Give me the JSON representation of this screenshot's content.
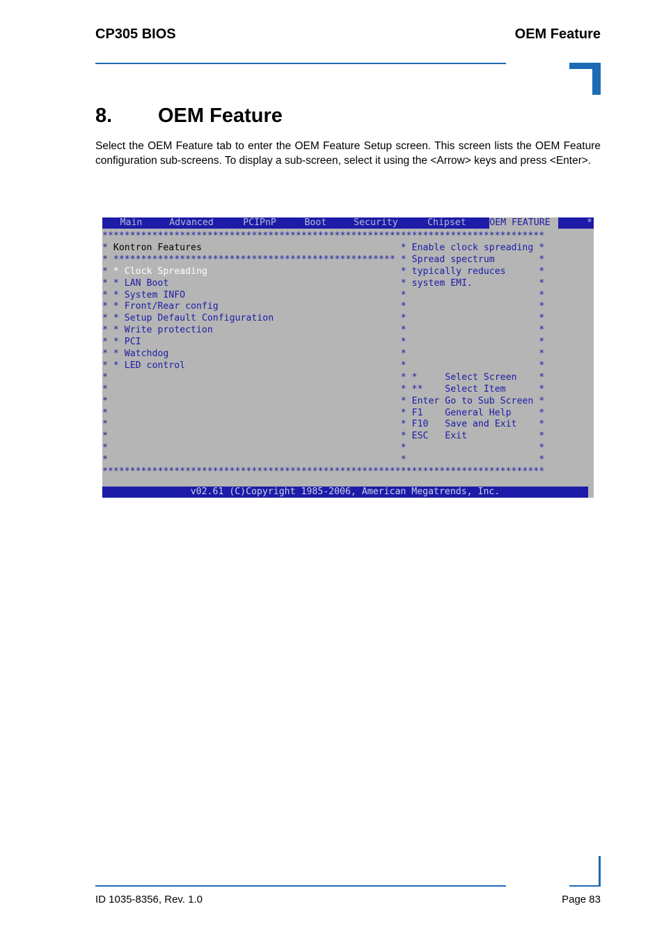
{
  "header": {
    "left": "CP305 BIOS",
    "right": "OEM Feature"
  },
  "section": {
    "number": "8.",
    "title": "OEM Feature"
  },
  "intro": "Select the OEM Feature tab to enter the OEM Feature Setup screen. This screen lists the OEM Feature configuration sub-screens. To display a sub-screen, select it using the <Arrow> keys and press <Enter>.",
  "bios": {
    "tabs": [
      {
        "label": "Main",
        "active": false
      },
      {
        "label": "Advanced",
        "active": false
      },
      {
        "label": "PCIPnP",
        "active": false
      },
      {
        "label": "Boot",
        "active": false
      },
      {
        "label": "Security",
        "active": false
      },
      {
        "label": "Chipset",
        "active": false
      },
      {
        "label": "OEM FEATURE",
        "active": true
      }
    ],
    "panel_title": "Kontron Features",
    "items": [
      {
        "label": "Clock Spreading",
        "selected": true
      },
      {
        "label": "LAN Boot",
        "selected": false
      },
      {
        "label": "System INFO",
        "selected": false
      },
      {
        "label": "Front/Rear config",
        "selected": false
      },
      {
        "label": "Setup Default Configuration",
        "selected": false
      },
      {
        "label": "Write protection",
        "selected": false
      },
      {
        "label": "PCI",
        "selected": false
      },
      {
        "label": "Watchdog",
        "selected": false
      },
      {
        "label": "LED control",
        "selected": false
      }
    ],
    "help_text": [
      "Enable clock spreading",
      "Spread spectrum",
      "typically reduces",
      "system EMI."
    ],
    "keys": [
      {
        "key": "*",
        "action": "Select Screen"
      },
      {
        "key": "**",
        "action": "Select Item"
      },
      {
        "key": "Enter",
        "action": "Go to Sub Screen"
      },
      {
        "key": "F1",
        "action": "General Help"
      },
      {
        "key": "F10",
        "action": "Save and Exit"
      },
      {
        "key": "ESC",
        "action": "Exit"
      }
    ],
    "footer": "v02.61 (C)Copyright 1985-2006, American Megatrends, Inc."
  },
  "footer": {
    "left": "ID 1035-8356, Rev. 1.0",
    "right": "Page 83"
  }
}
